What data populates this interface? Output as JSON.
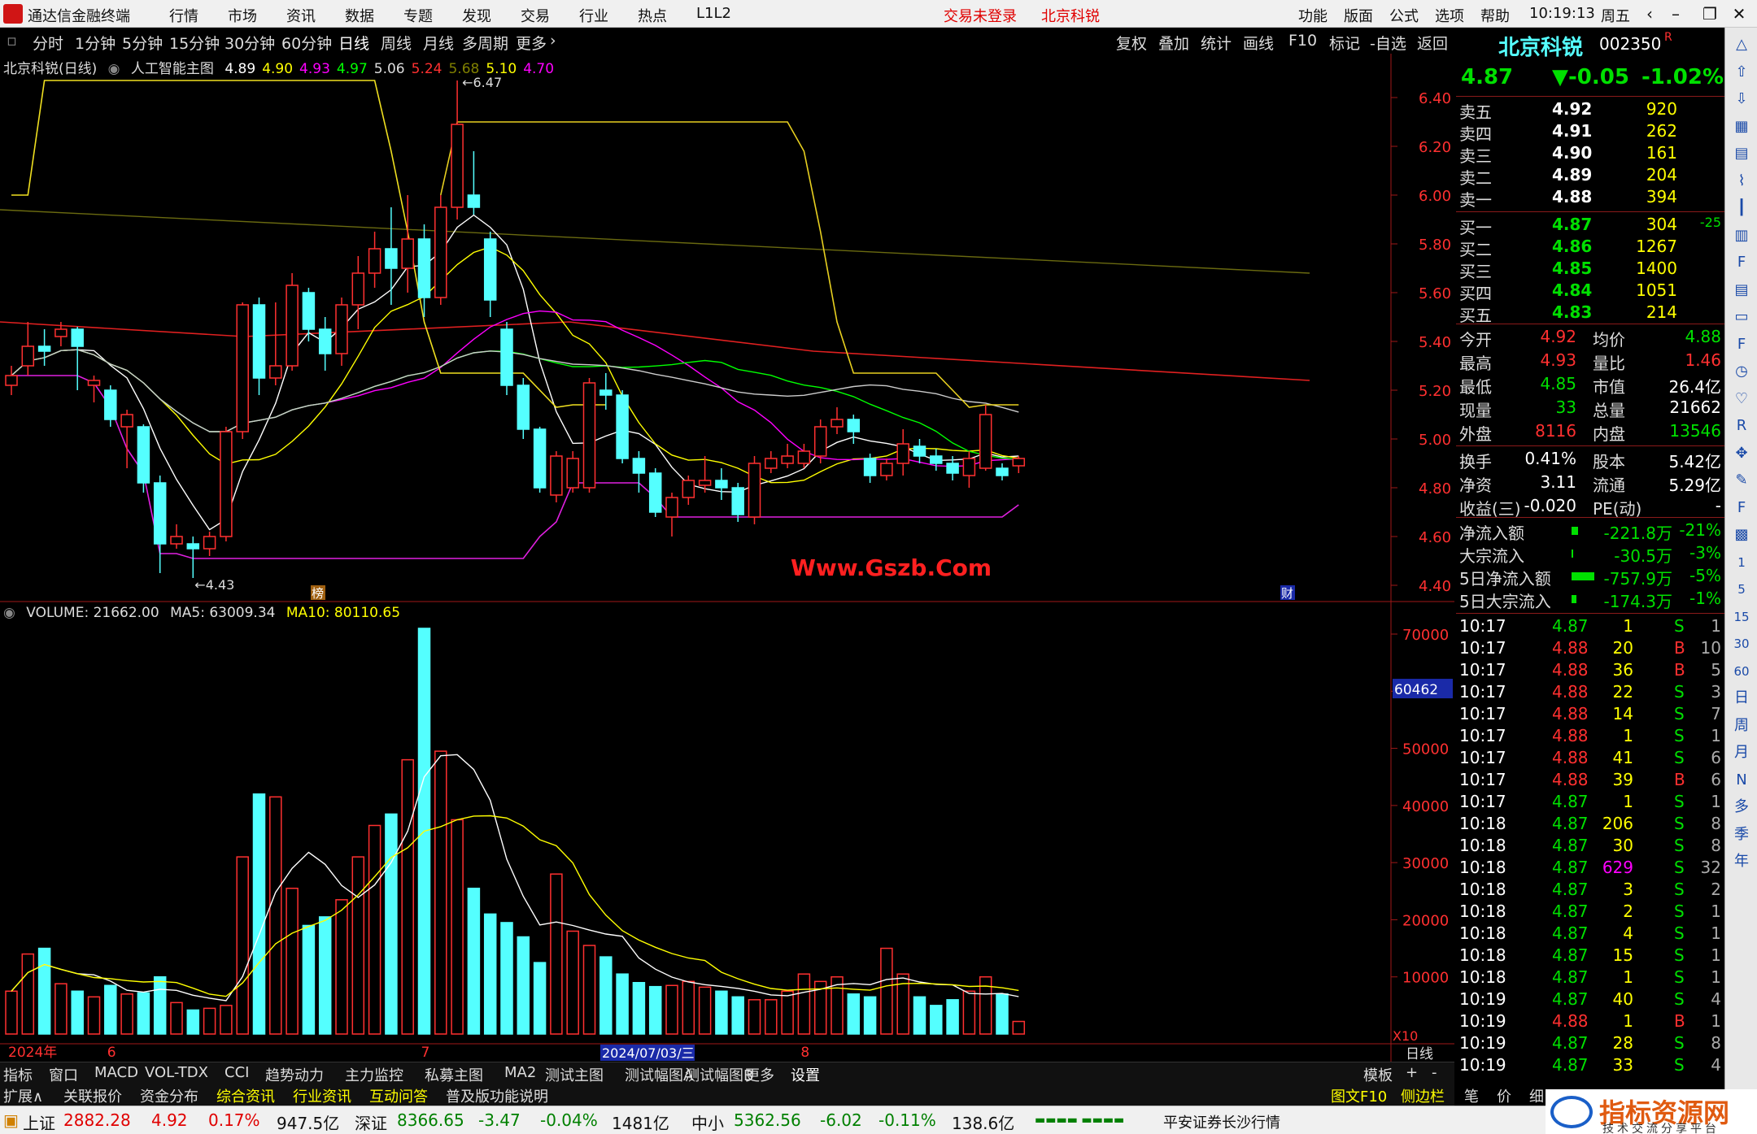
{
  "menubar": {
    "app_title": "通达信金融终端",
    "items": [
      "行情",
      "市场",
      "资讯",
      "数据",
      "专题",
      "发现",
      "交易",
      "行业",
      "热点",
      "L1L2"
    ],
    "login_status": "交易未登录",
    "stock_name": "北京科锐",
    "right_items": [
      "功能",
      "版面",
      "公式",
      "选项",
      "帮助"
    ],
    "time": "10:19:13",
    "weekday": "周五"
  },
  "toolbar": {
    "periods": [
      "分时",
      "1分钟",
      "5分钟",
      "15分钟",
      "30分钟",
      "60分钟",
      "日线",
      "周线",
      "月线",
      "多周期",
      "更多"
    ],
    "selected": "日线",
    "actions": [
      "复权",
      "叠加",
      "统计",
      "画线",
      "F10",
      "标记",
      "-自选",
      "返回"
    ]
  },
  "main_legend": {
    "title": "北京科锐(日线)",
    "indicator": "人工智能主图",
    "values": [
      {
        "text": "4.89",
        "color": "#ffffff"
      },
      {
        "text": "4.90",
        "color": "#ffff00"
      },
      {
        "text": "4.93",
        "color": "#ff00ff"
      },
      {
        "text": "4.97",
        "color": "#00ff00"
      },
      {
        "text": "5.06",
        "color": "#dddddd"
      },
      {
        "text": "5.24",
        "color": "#ff3030"
      },
      {
        "text": "5.68",
        "color": "#808000"
      },
      {
        "text": "5.10",
        "color": "#ffff00"
      },
      {
        "text": "4.70",
        "color": "#ff00ff"
      }
    ],
    "high_label": "6.47",
    "low_label": "4.43",
    "tag_bang": "榜",
    "tag_cai": "财"
  },
  "price_axis": [
    "6.40",
    "6.20",
    "6.00",
    "5.80",
    "5.60",
    "5.40",
    "5.20",
    "5.00",
    "4.80",
    "4.60",
    "4.40"
  ],
  "volume_legend": {
    "volume": "VOLUME: 21662.00",
    "ma5": "MA5: 63009.34",
    "ma10": "MA10: 80110.65"
  },
  "volume_axis": [
    "70000",
    "60000",
    "50000",
    "40000",
    "30000",
    "20000",
    "10000"
  ],
  "volume_marker": "60462",
  "volume_unit": "X10",
  "watermark": "Www.Gszb.Com",
  "date_axis": {
    "labels": [
      {
        "text": "2024年",
        "idx": 0
      },
      {
        "text": "6",
        "idx": 6
      },
      {
        "text": "7",
        "idx": 25
      },
      {
        "text": "8",
        "idx": 48
      }
    ],
    "cursor_date": "2024/07/03/三",
    "period": "日线"
  },
  "chart_data": {
    "type": "candlestick",
    "price_range": [
      4.4,
      6.47
    ],
    "candles": [
      [
        5.22,
        5.26,
        5.18,
        5.3
      ],
      [
        5.3,
        5.38,
        5.26,
        5.48
      ],
      [
        5.38,
        5.36,
        5.3,
        5.45
      ],
      [
        5.42,
        5.45,
        5.38,
        5.48
      ],
      [
        5.45,
        5.38,
        5.2,
        5.46
      ],
      [
        5.22,
        5.24,
        5.15,
        5.26
      ],
      [
        5.2,
        5.08,
        5.05,
        5.22
      ],
      [
        5.05,
        5.1,
        4.88,
        5.12
      ],
      [
        5.05,
        4.82,
        4.78,
        5.06
      ],
      [
        4.82,
        4.57,
        4.45,
        4.85
      ],
      [
        4.57,
        4.6,
        4.55,
        4.65
      ],
      [
        4.57,
        4.55,
        4.43,
        4.6
      ],
      [
        4.55,
        4.6,
        4.52,
        4.62
      ],
      [
        4.6,
        5.03,
        4.58,
        5.05
      ],
      [
        5.03,
        5.55,
        5.0,
        5.56
      ],
      [
        5.55,
        5.25,
        5.18,
        5.58
      ],
      [
        5.25,
        5.3,
        5.22,
        5.56
      ],
      [
        5.3,
        5.63,
        5.28,
        5.68
      ],
      [
        5.6,
        5.45,
        5.4,
        5.62
      ],
      [
        5.45,
        5.35,
        5.28,
        5.5
      ],
      [
        5.35,
        5.55,
        5.3,
        5.58
      ],
      [
        5.55,
        5.68,
        5.45,
        5.75
      ],
      [
        5.68,
        5.78,
        5.62,
        5.85
      ],
      [
        5.78,
        5.7,
        5.55,
        5.95
      ],
      [
        5.7,
        5.82,
        5.6,
        6.0
      ],
      [
        5.82,
        5.58,
        5.5,
        5.88
      ],
      [
        5.58,
        5.95,
        5.55,
        6.0
      ],
      [
        5.95,
        6.29,
        5.9,
        6.47
      ],
      [
        6.0,
        5.95,
        5.92,
        6.18
      ],
      [
        5.82,
        5.57,
        5.5,
        5.85
      ],
      [
        5.45,
        5.22,
        5.18,
        5.48
      ],
      [
        5.22,
        5.04,
        5.0,
        5.25
      ],
      [
        5.04,
        4.8,
        4.78,
        5.05
      ],
      [
        4.77,
        4.93,
        4.74,
        4.95
      ],
      [
        4.8,
        4.92,
        4.78,
        4.95
      ],
      [
        4.8,
        5.23,
        4.78,
        5.25
      ],
      [
        5.2,
        5.18,
        5.12,
        5.27
      ],
      [
        5.18,
        4.92,
        4.9,
        5.2
      ],
      [
        4.92,
        4.86,
        4.78,
        4.95
      ],
      [
        4.86,
        4.7,
        4.68,
        4.88
      ],
      [
        4.68,
        4.76,
        4.6,
        4.78
      ],
      [
        4.76,
        4.83,
        4.73,
        4.85
      ],
      [
        4.81,
        4.83,
        4.78,
        4.93
      ],
      [
        4.83,
        4.8,
        4.75,
        4.88
      ],
      [
        4.8,
        4.69,
        4.66,
        4.82
      ],
      [
        4.68,
        4.9,
        4.65,
        4.93
      ],
      [
        4.88,
        4.92,
        4.86,
        4.95
      ],
      [
        4.9,
        4.93,
        4.88,
        4.98
      ],
      [
        4.9,
        4.95,
        4.88,
        4.98
      ],
      [
        4.93,
        5.05,
        4.9,
        5.08
      ],
      [
        5.05,
        5.08,
        5.02,
        5.13
      ],
      [
        5.08,
        5.03,
        4.98,
        5.1
      ],
      [
        4.92,
        4.85,
        4.82,
        4.94
      ],
      [
        4.85,
        4.9,
        4.83,
        4.92
      ],
      [
        4.9,
        4.98,
        4.85,
        5.04
      ],
      [
        4.97,
        4.93,
        4.9,
        5.0
      ],
      [
        4.93,
        4.9,
        4.87,
        4.96
      ],
      [
        4.9,
        4.86,
        4.83,
        4.93
      ],
      [
        4.85,
        4.92,
        4.8,
        4.95
      ],
      [
        4.88,
        5.1,
        4.87,
        5.14
      ],
      [
        4.88,
        4.85,
        4.83,
        4.9
      ],
      [
        4.89,
        4.92,
        4.86,
        4.93
      ]
    ],
    "volume_range": [
      0,
      70000
    ],
    "volumes": [
      7500,
      14000,
      15000,
      8800,
      7500,
      6500,
      8500,
      7000,
      7200,
      10000,
      5500,
      4200,
      4500,
      5000,
      31000,
      42000,
      41500,
      25500,
      19000,
      20500,
      23500,
      31000,
      36500,
      38500,
      48000,
      71000,
      49500,
      37500,
      25500,
      21000,
      19500,
      17000,
      12500,
      28000,
      18000,
      15500,
      13500,
      10500,
      9000,
      8300,
      8500,
      9200,
      8200,
      7500,
      6500,
      6000,
      6000,
      7500,
      10500,
      9200,
      10000,
      7000,
      6500,
      15000,
      10500,
      6500,
      5000,
      6000,
      7500,
      10000,
      7000,
      2200
    ]
  },
  "quote": {
    "name": "北京科锐",
    "code": "002350",
    "r_mark": "R",
    "price": "4.87",
    "change": "▼-0.05",
    "pct": "-1.02%",
    "sells": [
      {
        "label": "卖五",
        "price": "4.92",
        "vol": "920"
      },
      {
        "label": "卖四",
        "price": "4.91",
        "vol": "262"
      },
      {
        "label": "卖三",
        "price": "4.90",
        "vol": "161"
      },
      {
        "label": "卖二",
        "price": "4.89",
        "vol": "204"
      },
      {
        "label": "卖一",
        "price": "4.88",
        "vol": "394"
      }
    ],
    "buys": [
      {
        "label": "买一",
        "price": "4.87",
        "vol": "304",
        "extra": "-25"
      },
      {
        "label": "买二",
        "price": "4.86",
        "vol": "1267",
        "extra": ""
      },
      {
        "label": "买三",
        "price": "4.85",
        "vol": "1400",
        "extra": ""
      },
      {
        "label": "买四",
        "price": "4.84",
        "vol": "1051",
        "extra": ""
      },
      {
        "label": "买五",
        "price": "4.83",
        "vol": "214",
        "extra": ""
      }
    ],
    "stats1": [
      {
        "l1": "今开",
        "v1": "4.92",
        "c1": "#ff3030",
        "l2": "均价",
        "v2": "4.88",
        "c2": "#00e000"
      },
      {
        "l1": "最高",
        "v1": "4.93",
        "c1": "#ff3030",
        "l2": "量比",
        "v2": "1.46",
        "c2": "#ff3030"
      },
      {
        "l1": "最低",
        "v1": "4.85",
        "c1": "#00e000",
        "l2": "市值",
        "v2": "26.4亿",
        "c2": "#ffffff"
      },
      {
        "l1": "现量",
        "v1": "33",
        "c1": "#00e000",
        "l2": "总量",
        "v2": "21662",
        "c2": "#ffffff"
      },
      {
        "l1": "外盘",
        "v1": "8116",
        "c1": "#ff3030",
        "l2": "内盘",
        "v2": "13546",
        "c2": "#00e000"
      }
    ],
    "stats2": [
      {
        "l1": "换手",
        "v1": "0.41%",
        "l2": "股本",
        "v2": "5.42亿"
      },
      {
        "l1": "净资",
        "v1": "3.11",
        "l2": "流通",
        "v2": "5.29亿"
      },
      {
        "l1": "收益(三)",
        "v1": "-0.020",
        "l2": "PE(动)",
        "v2": "-"
      }
    ],
    "flows": [
      {
        "label": "净流入额",
        "value": "-221.8万",
        "pct": "-21%",
        "bar": 8
      },
      {
        "label": "大宗流入",
        "value": "-30.5万",
        "pct": "-3%",
        "bar": 2
      },
      {
        "label": "5日净流入额",
        "value": "-757.9万",
        "pct": "-5%",
        "bar": 28
      },
      {
        "label": "5日大宗流入",
        "value": "-174.3万",
        "pct": "-1%",
        "bar": 6
      }
    ],
    "ticks": [
      {
        "t": "10:17",
        "p": "4.87",
        "v": "1",
        "d": "S",
        "n": "1"
      },
      {
        "t": "10:17",
        "p": "4.88",
        "v": "20",
        "d": "B",
        "n": "10"
      },
      {
        "t": "10:17",
        "p": "4.88",
        "v": "36",
        "d": "B",
        "n": "5"
      },
      {
        "t": "10:17",
        "p": "4.88",
        "v": "22",
        "d": "S",
        "n": "3"
      },
      {
        "t": "10:17",
        "p": "4.88",
        "v": "14",
        "d": "S",
        "n": "7"
      },
      {
        "t": "10:17",
        "p": "4.88",
        "v": "1",
        "d": "S",
        "n": "1"
      },
      {
        "t": "10:17",
        "p": "4.88",
        "v": "41",
        "d": "S",
        "n": "6"
      },
      {
        "t": "10:17",
        "p": "4.88",
        "v": "39",
        "d": "B",
        "n": "6"
      },
      {
        "t": "10:17",
        "p": "4.87",
        "v": "1",
        "d": "S",
        "n": "1"
      },
      {
        "t": "10:18",
        "p": "4.87",
        "v": "206",
        "d": "S",
        "n": "8"
      },
      {
        "t": "10:18",
        "p": "4.87",
        "v": "30",
        "d": "S",
        "n": "8"
      },
      {
        "t": "10:18",
        "p": "4.87",
        "v": "629",
        "d": "S",
        "n": "32"
      },
      {
        "t": "10:18",
        "p": "4.87",
        "v": "3",
        "d": "S",
        "n": "2"
      },
      {
        "t": "10:18",
        "p": "4.87",
        "v": "2",
        "d": "S",
        "n": "1"
      },
      {
        "t": "10:18",
        "p": "4.87",
        "v": "4",
        "d": "S",
        "n": "1"
      },
      {
        "t": "10:18",
        "p": "4.87",
        "v": "15",
        "d": "S",
        "n": "1"
      },
      {
        "t": "10:18",
        "p": "4.87",
        "v": "1",
        "d": "S",
        "n": "1"
      },
      {
        "t": "10:19",
        "p": "4.87",
        "v": "40",
        "d": "S",
        "n": "4"
      },
      {
        "t": "10:19",
        "p": "4.88",
        "v": "1",
        "d": "B",
        "n": "1"
      },
      {
        "t": "10:19",
        "p": "4.87",
        "v": "28",
        "d": "S",
        "n": "8"
      },
      {
        "t": "10:19",
        "p": "4.87",
        "v": "33",
        "d": "S",
        "n": "4"
      }
    ]
  },
  "icon_strip": [
    "up-icon",
    "up-arrow-icon",
    "down-arrow-icon",
    "grid-icon",
    "table-icon",
    "line-icon",
    "kline-icon",
    "list-icon",
    "f10-icon",
    "doc-icon",
    "tag-icon",
    "fs-icon",
    "clock-icon",
    "heart-icon",
    "rsi-icon",
    "move-icon",
    "pen-icon",
    "fs2-icon",
    "green-icon",
    "1-icon",
    "5-icon",
    "15-icon",
    "30-icon",
    "60-icon",
    "日",
    "周",
    "月",
    "N",
    "多",
    "季",
    "年"
  ],
  "tabs1": [
    "指标",
    "窗口",
    "MACD",
    "VOL-TDX",
    "CCI",
    "趋势动力",
    "主力监控",
    "私募主图",
    "MA2",
    "测试主图",
    "测试幅图A",
    "测试幅图B",
    "更多",
    "设置"
  ],
  "tabs1_right": [
    "模板",
    "+",
    "-"
  ],
  "tabs2": [
    "扩展∧",
    "关联报价",
    "资金分布",
    "综合资讯",
    "行业资讯",
    "互动问答",
    "普及版功能说明"
  ],
  "tabs2_right": [
    "图文F10",
    "侧边栏《",
    "笔",
    "价",
    "细"
  ],
  "statusbar": {
    "sh_label": "上证",
    "sh_val": "2882.28",
    "sh_chg": "4.92",
    "sh_pct": "0.17%",
    "sh_amt": "947.5亿",
    "sz_label": "深证",
    "sz_val": "8366.65",
    "sz_chg": "-3.47",
    "sz_pct": "-0.04%",
    "sz_amt": "1481亿",
    "zx_label": "中小",
    "zx_val": "5362.56",
    "zx_chg": "-6.02",
    "zx_pct": "-0.11%",
    "zx_amt": "138.6亿",
    "broker": "平安证券长沙行情"
  },
  "brand": {
    "title": "指标资源网",
    "subtitle": "技术交流分享平台"
  }
}
